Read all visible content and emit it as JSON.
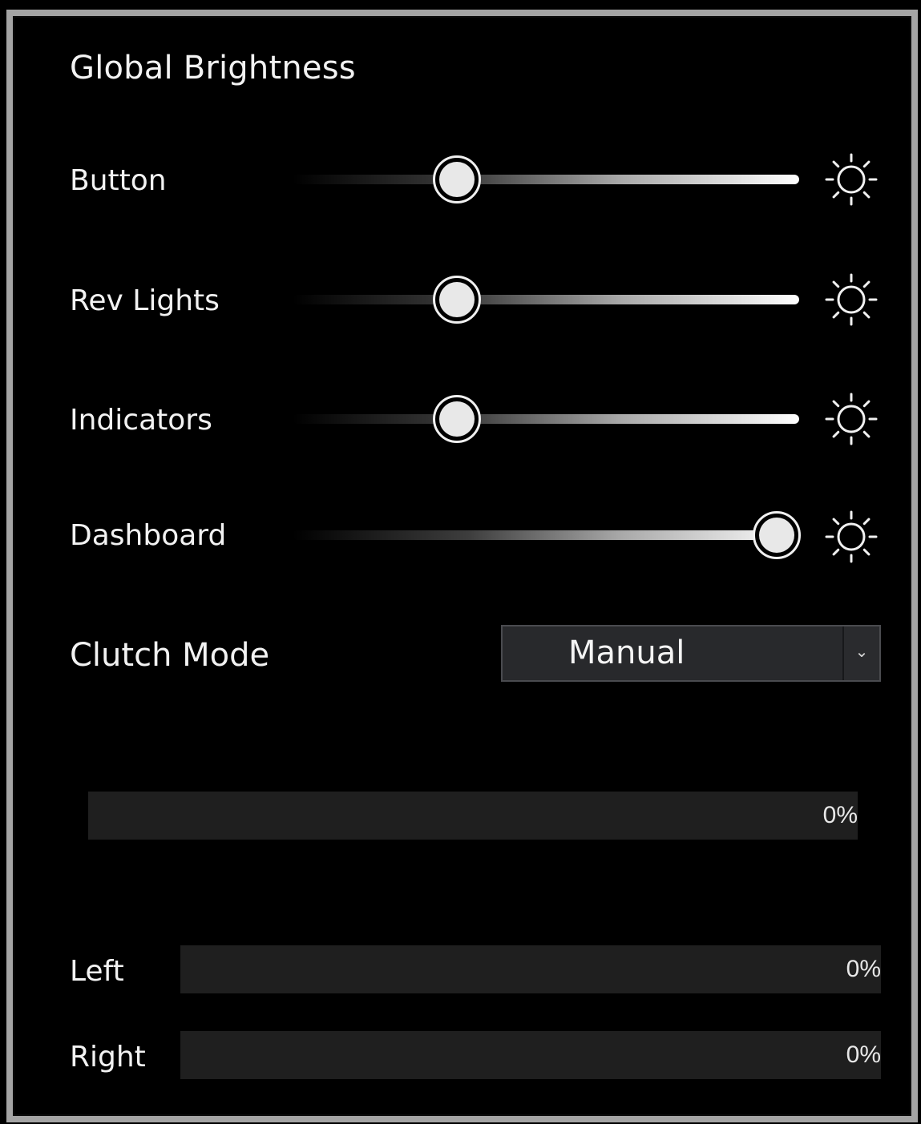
{
  "title": "Global Brightness",
  "sliders": [
    {
      "label": "Button",
      "value": 0.325
    },
    {
      "label": "Rev Lights",
      "value": 0.325
    },
    {
      "label": "Indicators",
      "value": 0.325
    },
    {
      "label": "Dashboard",
      "value": 0.955
    }
  ],
  "icons": {
    "brightness": "sun-icon"
  },
  "clutch": {
    "label": "Clutch Mode",
    "selected": "Manual"
  },
  "clutch_bar": {
    "percent_text": "0%",
    "value": 0
  },
  "paddles": [
    {
      "label": "Left",
      "percent_text": "0%",
      "value": 0
    },
    {
      "label": "Right",
      "percent_text": "0%",
      "value": 0
    }
  ],
  "colors": {
    "background": "#000000",
    "frame": "#a4a4a4",
    "bar_bg": "#1f1f1f",
    "select_bg": "#28292c"
  }
}
